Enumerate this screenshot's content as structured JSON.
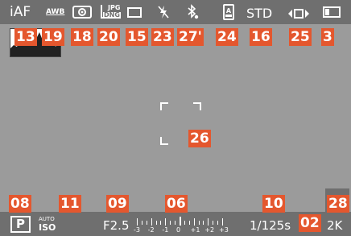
{
  "top": {
    "focus_mode": "iAF",
    "white_balance": "AWB",
    "file_format_top": "JPG",
    "file_format_bottom": "DNG",
    "photo_style": "STD"
  },
  "bottom": {
    "exposure_mode": "P",
    "iso_top": "AUTO",
    "iso_bottom": "ISO",
    "aperture": "F2.5",
    "scale_labels": [
      "-3",
      "-2",
      "-1",
      "0",
      "+1",
      "+2",
      "+3"
    ],
    "shutter": "1/125s",
    "battery_resolution": "2K"
  },
  "icons": {
    "metering": "spot-metering-icon",
    "drive": "single-shot-icon",
    "flash_off": "flash-off-icon",
    "bluetooth": "bluetooth-icon",
    "af_assist": "af-assist-icon",
    "stabilizer": "stabilizer-icon",
    "battery": "battery-icon",
    "histogram": "histogram-icon",
    "camera": "camera-icon"
  },
  "callouts": {
    "c13": "13",
    "c19": "19",
    "c18": "18",
    "c20": "20",
    "c15": "15",
    "c23": "23",
    "c27": "27'",
    "c24": "24",
    "c16": "16",
    "c25": "25",
    "c3": "3",
    "c26": "26",
    "c08": "08",
    "c11": "11",
    "c09": "09",
    "c06": "06",
    "c10": "10",
    "c28": "28",
    "c02": "02"
  },
  "colors": {
    "callout": "#e4572e",
    "bar": "#6f6f6f",
    "background": "#9b9b9b"
  }
}
